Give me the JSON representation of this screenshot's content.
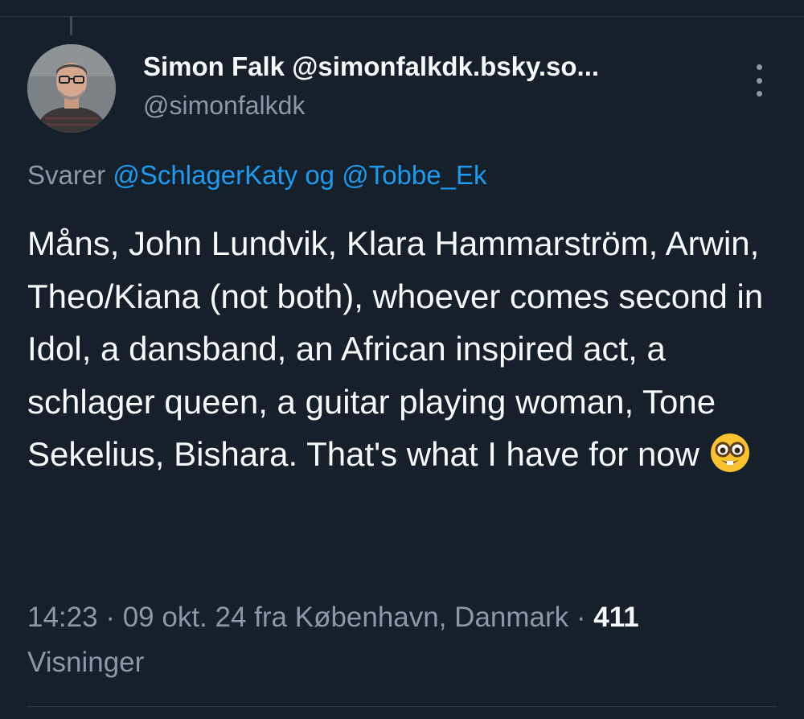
{
  "tweet": {
    "display_name": "Simon Falk @simonfalkdk.bsky.so...",
    "handle": "@simonfalkdk",
    "reply_prefix": "Svarer ",
    "reply_mention_1": "@SchlagerKaty",
    "reply_joiner": " og ",
    "reply_mention_2": "@Tobbe_Ek",
    "text": "Måns, John Lundvik, Klara Hammarström, Arwin, Theo/Kiana (not both), whoever comes second in Idol, a dansband, an African inspired act, a schlager queen, a guitar playing woman, Tone Sekelius, Bishara. That's what I have for now ",
    "emoji": "nerd-face-icon",
    "time": "14:23",
    "separator": " · ",
    "date_location": "09 okt. 24 fra København, Danmark",
    "views_count": "411",
    "views_label": "Visninger"
  },
  "colors": {
    "background": "#15202b",
    "text_primary": "#f7f9f9",
    "text_secondary": "#8b98a5",
    "link": "#1d9bf0",
    "divider": "#2f3a45"
  }
}
